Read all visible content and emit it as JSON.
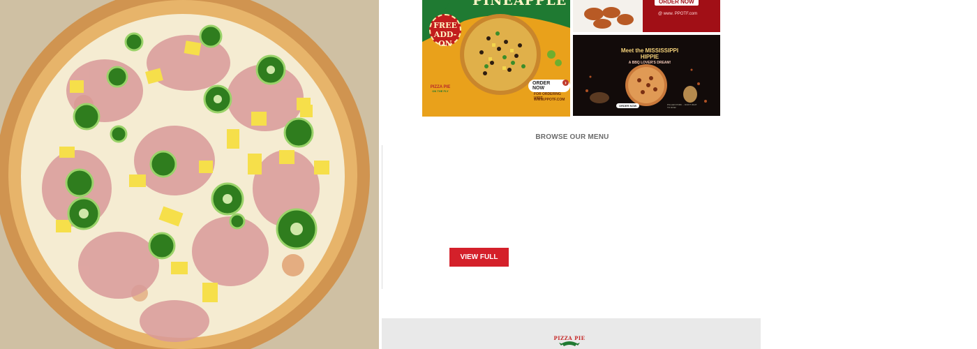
{
  "hero": {
    "image": "pizza-photo"
  },
  "promos": {
    "pineapple": {
      "title": "PINEAPPLE",
      "badge": "FREE ADD-ON",
      "order_label": "ORDER NOW",
      "order_info": "FOR ORDERING VISIT",
      "url": "WWW.PPOTF.COM",
      "brand": "PIZZA PIE",
      "brand_tag": "ON THE FLY"
    },
    "wings": {
      "order_label": "ORDER NOW",
      "url": "@ www. PPOTF.com"
    },
    "hippie": {
      "title": "Meet the MISSISSIPPI HIPPIE",
      "subtitle": "A BBQ LOVER'S DREAM!",
      "order_label": "ORDER NOW",
      "note": "PULLED PORK ... DON'T WAIT TO DIVE!"
    }
  },
  "menu_section": {
    "heading": "BROWSE OUR MENU",
    "button_label": "VIEW FULL MENU"
  },
  "footer": {
    "logo_text": "PIZZA PIE"
  },
  "colors": {
    "accent_red": "#d4202a",
    "footer_bg": "#e9e9e9"
  }
}
